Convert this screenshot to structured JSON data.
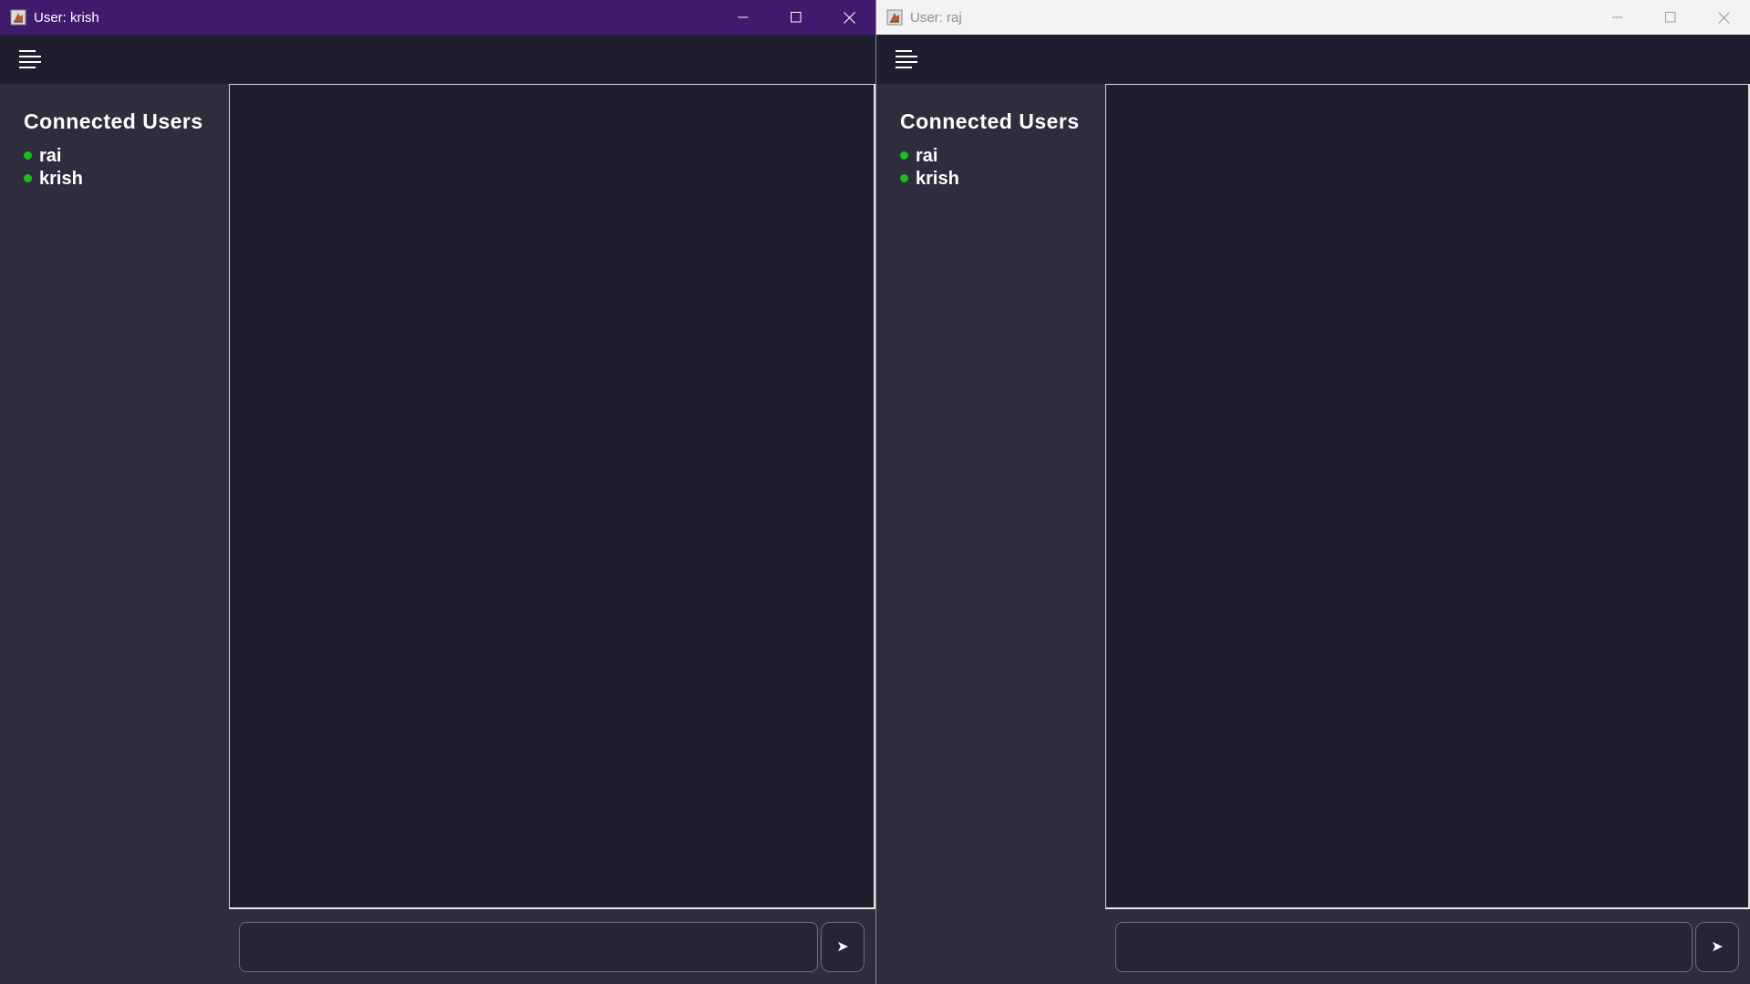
{
  "windows": [
    {
      "title": "User: krish",
      "active": true,
      "sidebar": {
        "title": "Connected Users",
        "users": [
          {
            "name": "rai",
            "status": "online"
          },
          {
            "name": "krish",
            "status": "online"
          }
        ]
      },
      "message_input": {
        "value": "",
        "placeholder": ""
      },
      "send_button": {
        "label": "➤"
      }
    },
    {
      "title": "User: raj",
      "active": false,
      "sidebar": {
        "title": "Connected Users",
        "users": [
          {
            "name": "rai",
            "status": "online"
          },
          {
            "name": "krish",
            "status": "online"
          }
        ]
      },
      "message_input": {
        "value": "",
        "placeholder": ""
      },
      "send_button": {
        "label": "➤"
      }
    }
  ],
  "colors": {
    "active_titlebar": "#3f1a6d",
    "inactive_titlebar": "#f3f3f3",
    "app_background": "#1f1e2e",
    "sidebar_background": "#2e2d3e",
    "online_dot": "#1bbf1b"
  },
  "icons": {
    "app": "java-app-icon",
    "menu": "hamburger-menu-icon",
    "minimize": "minimize-icon",
    "maximize": "maximize-icon",
    "close": "close-icon",
    "send": "send-arrow-icon"
  }
}
